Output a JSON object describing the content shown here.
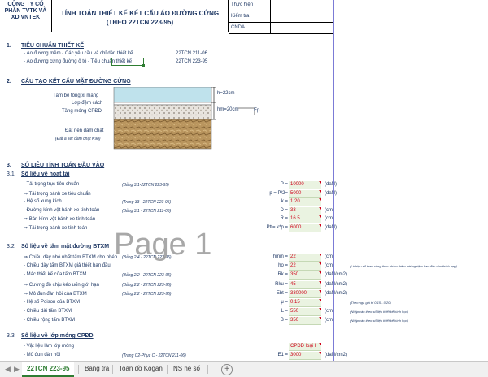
{
  "header": {
    "company": [
      "CÔNG TY CỔ",
      "PHẦN TVTK VÀ",
      "XD VNTEK"
    ],
    "title_line1": "TÍNH TOÁN THIẾT KẾ KẾT CẤU ÁO ĐƯỜNG CỨNG",
    "title_line2": "(THEO 22TCN 223-95)",
    "sign_rows": [
      "Thực hiện",
      "Kiểm tra",
      "CNDA"
    ]
  },
  "s1": {
    "num": "1.",
    "title": "TIÊU CHUẨN THIẾT KẾ",
    "items": [
      {
        "text": "- Áo đường mềm - Các yêu cầu và chỉ dẫn thiết kế",
        "code": "22TCN 211-06"
      },
      {
        "text": "- Áo đường cứng đường ô tô - Tiêu chuẩn thiết kế",
        "code": "22TCN 223-95"
      }
    ]
  },
  "s2": {
    "num": "2.",
    "title": "CẤU TẠO KẾT CẤU MẶT ĐƯỜNG CỨNG",
    "layers": [
      "Tấm bê tông xi măng",
      "Lớp đệm cách",
      "Tầng móng CPĐD",
      "Đất nền đầm chặt"
    ],
    "soil_note": "(Đất á sét đầm chặt K98)",
    "dim_h": "h=22cm",
    "dim_hm": "hm=20cm",
    "ep": "Ep"
  },
  "s3": {
    "num": "3.",
    "title": "SỐ LIỆU TÍNH TOÁN ĐẦU VÀO",
    "load": {
      "num": "3.1",
      "title": "Số liệu về hoạt tải",
      "rows": [
        {
          "label": "- Tải trọng trục tiêu chuẩn",
          "ref": "(Bảng 3.1-22TCN 223-95)",
          "sym": "P =",
          "val": "10000",
          "unit": "(daN)"
        },
        {
          "label": "⇒ Tải trọng bánh xe tiêu chuẩn",
          "ref": "",
          "sym": "p = P/2=",
          "val": "5000",
          "unit": "(daN)"
        },
        {
          "label": "- Hệ số xung kích",
          "ref": "(Trang 33 - 22TCN 223-95)",
          "sym": "k =",
          "val": "1.20",
          "unit": ""
        },
        {
          "label": "- Đường kính vệt bánh xe tính toán",
          "ref": "(Bảng 3.1 - 22TCN 211-06)",
          "sym": "D =",
          "val": "33",
          "unit": "(cm)"
        },
        {
          "label": "⇒ Bán kính vệt bánh xe tính toán",
          "ref": "",
          "sym": "R =",
          "val": "16.5",
          "unit": "(cm)"
        },
        {
          "label": "⇒ Tải trọng bánh xe tính toán",
          "ref": "",
          "sym": "Ptt= k*p =",
          "val": "6000",
          "unit": "(daN)"
        }
      ]
    },
    "slab": {
      "num": "3.2",
      "title": "Số liệu về tấm mặt đường BTXM",
      "rows": [
        {
          "label": "⇒ Chiều dày nhỏ nhất tấm BTXM cho phép",
          "ref": "(Bảng 2.4 - 22TCN 223-95)",
          "sym": "hmin =",
          "val": "22",
          "unit": "(cm)",
          "note": ""
        },
        {
          "label": "- Chiều dày tấm BTXM giả thiết ban đầu",
          "ref": "",
          "sym": "ho =",
          "val": "22",
          "unit": "(cm)",
          "note": "(Là hiệu số theo công thức nhằm thêm bớt nghiệm ban đầu cho thích hợp)"
        },
        {
          "label": "- Mác thiết kế của tấm BTXM",
          "ref": "(Bảng 2.2 - 22TCN 223-95)",
          "sym": "Rk =",
          "val": "350",
          "unit": "(daN/cm2)",
          "note": ""
        },
        {
          "label": "⇒ Cường độ chịu kéo uốn giới hạn",
          "ref": "(Bảng 2.2 - 22TCN 223-95)",
          "sym": "Rku =",
          "val": "45",
          "unit": "(daN/cm2)",
          "note": ""
        },
        {
          "label": "⇒ Mô đun đàn hồi của BTXM",
          "ref": "(Bảng 2.2 - 22TCN 223-95)",
          "sym": "Ebt =",
          "val": "330000",
          "unit": "(daN/cm2)",
          "note": ""
        },
        {
          "label": "- Hệ số Poison của BTXM",
          "ref": "",
          "sym": "μ =",
          "val": "0.15",
          "unit": "",
          "note": "(Theo ngả giá trị 0.15 - 0.20)"
        },
        {
          "label": "- Chiều dài tấm BTXM",
          "ref": "",
          "sym": "L =",
          "val": "550",
          "unit": "(cm)",
          "note": "(Nhập vào theo số liệu thiết kế hình học)"
        },
        {
          "label": "- Chiều rộng tấm BTXM",
          "ref": "",
          "sym": "B =",
          "val": "350",
          "unit": "(cm)",
          "note": "(Nhập vào theo số liệu thiết kế hình học)"
        }
      ]
    },
    "base": {
      "num": "3.3",
      "title": "Số liệu về lớp móng CPĐD",
      "rows": [
        {
          "label": "- Vật liệu làm lớp móng",
          "ref": "",
          "sym": "",
          "val": "CPĐD loại I",
          "unit": ""
        },
        {
          "label": "- Mô đun đàn hồi",
          "ref": "(Trang C2-Phục C - 22TCN 211-06)",
          "sym": "E1 =",
          "val": "3000",
          "unit": "(daN/cm2)"
        }
      ]
    }
  },
  "watermark": "Page 1",
  "tabs": [
    "22TCN 223-95",
    "Bảng tra",
    "Toán đồ Kogan",
    "NS hệ số"
  ],
  "active_tab": 0,
  "colors": {
    "text": "#1f3864",
    "value_red": "#d0021b",
    "active_tab": "#2e7d32",
    "input_bg": "#eaf3e1"
  }
}
